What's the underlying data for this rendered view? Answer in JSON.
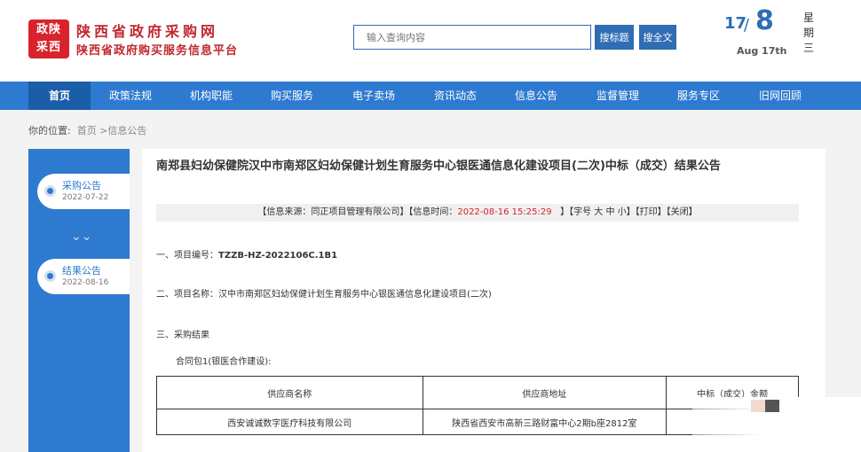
{
  "header": {
    "logo_text_top": "政陕",
    "logo_text_bottom": "采西",
    "site_name": "陕西省政府采购网",
    "site_subtitle": "陕西省政府购买服务信息平台",
    "search_placeholder": "输入查询内容",
    "btn_search_title": "搜标题",
    "btn_search_full": "搜全文",
    "date_day": "17",
    "date_slash": "/",
    "date_month": "8",
    "date_en": "Aug 17th",
    "weekday_chars": [
      "星",
      "期",
      "三"
    ]
  },
  "nav": {
    "items": [
      "首页",
      "政策法规",
      "机构职能",
      "购买服务",
      "电子卖场",
      "资讯动态",
      "信息公告",
      "监督管理",
      "服务专区",
      "旧网回顾"
    ],
    "active_index": 0
  },
  "breadcrumb": {
    "prefix": "你的位置:",
    "path": "首页 >信息公告"
  },
  "sidebar": {
    "steps": [
      {
        "label": "采购公告",
        "date": "2022-07-22"
      },
      {
        "label": "结果公告",
        "date": "2022-08-16"
      }
    ],
    "arrow_glyph": "⌄⌄"
  },
  "article": {
    "title": "南郑县妇幼保健院汉中市南郑区妇幼保健计划生育服务中心银医通信息化建设项目(二次)中标（成交）结果公告",
    "info_source_label": "【信息来源：",
    "info_source": "同正项目管理有限公司",
    "info_time_label": "】【信息时间：",
    "info_time": "2022-08-16 15:25:29",
    "info_font": "】【字号 大 中 小】",
    "info_print": "【打印】",
    "info_close": "【关闭】",
    "sec1_label": "一、项目编号：",
    "sec1_value": "TZZB-HZ-2022106C.1B1",
    "sec2_label": "二、项目名称：",
    "sec2_value": "汉中市南郑区妇幼保健计划生育服务中心银医通信息化建设项目(二次)",
    "sec3_label": "三、采购结果",
    "package_label": "合同包1(银医合作建设):",
    "table": {
      "headers": [
        "供应商名称",
        "供应商地址",
        "中标（成交）金额"
      ],
      "rows": [
        [
          "西安诚诚数字医疗科技有限公司",
          "陕西省西安市高新三路财富中心2期b座2812室",
          ""
        ]
      ]
    }
  }
}
